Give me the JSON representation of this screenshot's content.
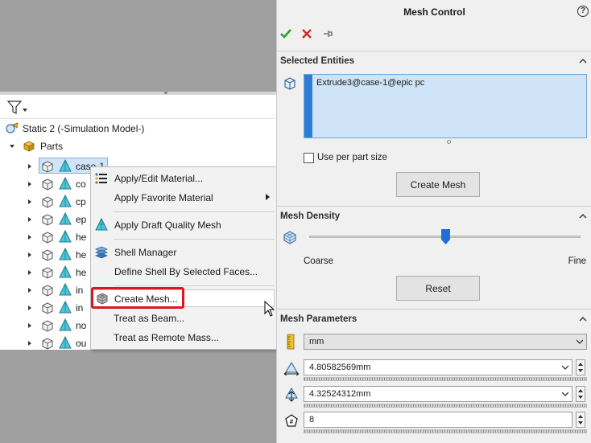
{
  "tree": {
    "root_label": "Static 2 (-Simulation Model-)",
    "parts_label": "Parts",
    "items": [
      {
        "label": "case-1"
      },
      {
        "label": "co"
      },
      {
        "label": "cp"
      },
      {
        "label": "ep"
      },
      {
        "label": "he"
      },
      {
        "label": "he"
      },
      {
        "label": "he"
      },
      {
        "label": "in"
      },
      {
        "label": "in"
      },
      {
        "label": "no"
      },
      {
        "label": "ou"
      }
    ]
  },
  "context_menu": {
    "items": [
      {
        "label": "Apply/Edit Material...",
        "icon": "material-list-icon"
      },
      {
        "label": "Apply Favorite Material",
        "icon": "none",
        "submenu": true
      },
      {
        "label": "Apply Draft Quality Mesh",
        "icon": "draft-mesh-icon"
      },
      {
        "label": "Shell Manager",
        "icon": "shell-stack-icon"
      },
      {
        "label": "Define Shell By Selected Faces...",
        "icon": "none"
      },
      {
        "label": "Create Mesh...",
        "icon": "mesh-icon",
        "highlighted": true
      },
      {
        "label": "Treat as Beam...",
        "icon": "none"
      },
      {
        "label": "Treat as Remote Mass...",
        "icon": "none"
      }
    ]
  },
  "property_manager": {
    "title": "Mesh Control",
    "help": "?",
    "selected_entities": {
      "title": "Selected Entities",
      "value": "Extrude3@case-1@epic pc",
      "use_per_part_size_label": "Use per part size",
      "use_per_part_size_checked": false,
      "create_mesh_button": "Create Mesh"
    },
    "mesh_density": {
      "title": "Mesh Density",
      "coarse_label": "Coarse",
      "fine_label": "Fine",
      "slider_fraction": 0.5,
      "reset_button": "Reset"
    },
    "mesh_parameters": {
      "title": "Mesh Parameters",
      "unit": "mm",
      "element_size": "4.80582569mm",
      "tolerance": "4.32524312mm",
      "layers": "8"
    }
  },
  "colors": {
    "accent_green": "#2f9e2f",
    "cancel_red": "#d42a1f",
    "highlight_red": "#e0141e",
    "selection_blue": "#cfe4f7",
    "slider_blue": "#1e6fd6"
  }
}
